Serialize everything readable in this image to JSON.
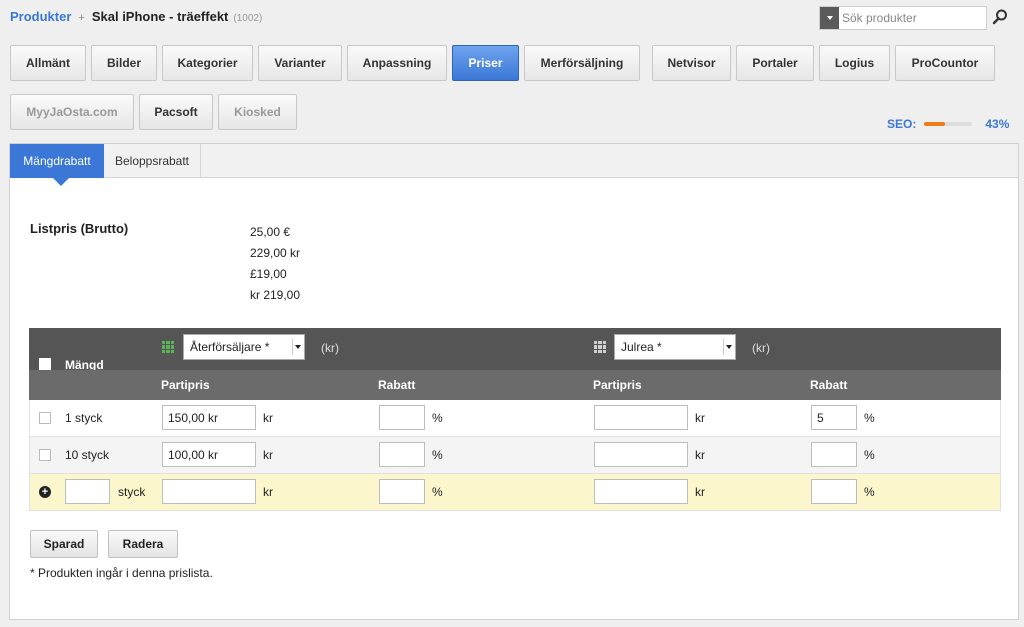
{
  "header": {
    "breadcrumb": "Produkter",
    "separator": "+",
    "title": "Skal iPhone - träeffekt",
    "product_id": "(1002)",
    "search_placeholder": "Sök produkter"
  },
  "tabs": {
    "allmant": "Allmänt",
    "bilder": "Bilder",
    "kategorier": "Kategorier",
    "varianter": "Varianter",
    "anpassning": "Anpassning",
    "priser": "Priser",
    "merforsaljning": "Merförsäljning",
    "netvisor": "Netvisor",
    "portaler": "Portaler",
    "logius": "Logius",
    "procountor": "ProCountor",
    "myyjaosta": "MyyJaOsta.com",
    "pacsoft": "Pacsoft",
    "kiosked": "Kiosked"
  },
  "seo": {
    "label": "SEO:",
    "value": "43%",
    "percent": 43
  },
  "subtabs": {
    "mangdrabatt": "Mängdrabatt",
    "beloppsrabatt": "Beloppsrabatt"
  },
  "listpris": {
    "label": "Listpris (Brutto)",
    "values": [
      "25,00 €",
      "229,00 kr",
      "£19,00",
      "kr 219,00"
    ]
  },
  "grid": {
    "mangd_label": "Mängd",
    "pricelist1": {
      "name": "Återförsäljare *",
      "currency": "(kr)"
    },
    "pricelist2": {
      "name": "Julrea *",
      "currency": "(kr)"
    },
    "col_partipris": "Partipris",
    "col_rabatt": "Rabatt",
    "unit_kr": "kr",
    "unit_pct": "%",
    "rows": [
      {
        "qty": "1 styck",
        "p1_price": "150,00 kr",
        "p1_rabatt": "",
        "p2_price": "",
        "p2_rabatt": "5"
      },
      {
        "qty": "10 styck",
        "p1_price": "100,00 kr",
        "p1_rabatt": "",
        "p2_price": "",
        "p2_rabatt": ""
      }
    ],
    "new_row": {
      "unit": "styck"
    }
  },
  "buttons": {
    "save": "Sparad",
    "delete": "Radera"
  },
  "footnote": "* Produkten ingår i denna prislista.",
  "colors": {
    "accent": "#3a77d6",
    "seo_bar": "#ef7d1a",
    "new_row_bg": "#fbf6cc",
    "grid_icon_green": "#5bb25b"
  }
}
